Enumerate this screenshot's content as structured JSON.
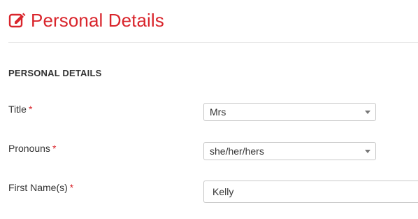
{
  "header": {
    "title": "Personal Details",
    "icon": "edit-icon",
    "accent_color": "#d9252c"
  },
  "section": {
    "heading": "PERSONAL DETAILS"
  },
  "fields": {
    "title": {
      "label": "Title",
      "required_marker": "*",
      "value": "Mrs"
    },
    "pronouns": {
      "label": "Pronouns",
      "required_marker": "*",
      "value": "she/her/hers"
    },
    "first_names": {
      "label": "First Name(s)",
      "required_marker": "*",
      "value": "Kelly"
    }
  }
}
